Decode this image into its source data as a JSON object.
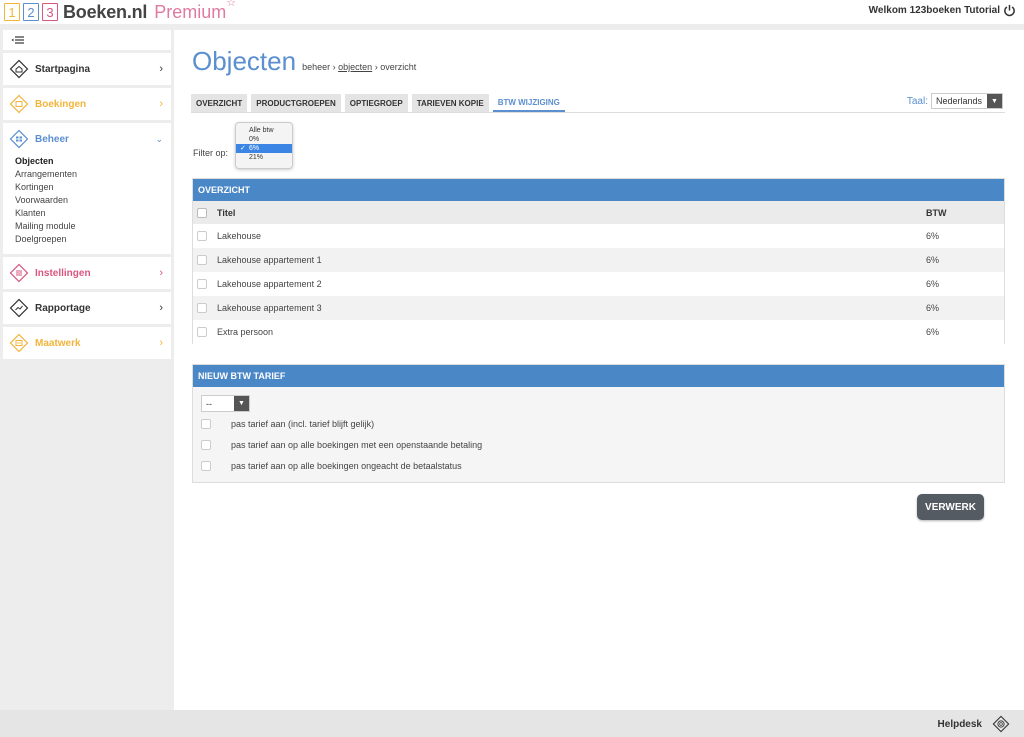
{
  "header": {
    "logo_digits": [
      "1",
      "2",
      "3"
    ],
    "brand": "Boeken.nl",
    "premium": "Premium",
    "welcome": "Welkom 123boeken Tutorial"
  },
  "sidebar": {
    "items": [
      {
        "label": "Startpagina",
        "color": "#333333"
      },
      {
        "label": "Boekingen",
        "color": "#f2b53c"
      },
      {
        "label": "Beheer",
        "color": "#5b8fcf"
      },
      {
        "label": "Instellingen",
        "color": "#d9577f"
      },
      {
        "label": "Rapportage",
        "color": "#333333"
      },
      {
        "label": "Maatwerk",
        "color": "#f2b53c"
      }
    ],
    "beheer_sub": [
      "Objecten",
      "Arrangementen",
      "Kortingen",
      "Voorwaarden",
      "Klanten",
      "Mailing module",
      "Doelgroepen"
    ]
  },
  "main": {
    "title": "Objecten",
    "breadcrumb": {
      "part1": "beheer",
      "sep": "›",
      "part2": "objecten",
      "part3": "overzicht"
    },
    "tabs": [
      "OVERZICHT",
      "PRODUCTGROEPEN",
      "OPTIEGROEP",
      "TARIEVEN KOPIE",
      "BTW WIJZIGING"
    ],
    "active_tab": "BTW WIJZIGING",
    "taal_label": "Taal:",
    "taal_value": "Nederlands",
    "filter_label": "Filter op:",
    "filter_options": [
      "Alle btw",
      "0%",
      "6%",
      "21%"
    ],
    "filter_selected": "6%"
  },
  "overzicht": {
    "heading": "OVERZICHT",
    "col_title": "Titel",
    "col_btw": "BTW",
    "rows": [
      {
        "title": "Lakehouse",
        "btw": "6%"
      },
      {
        "title": "Lakehouse appartement 1",
        "btw": "6%"
      },
      {
        "title": "Lakehouse appartement 2",
        "btw": "6%"
      },
      {
        "title": "Lakehouse appartement 3",
        "btw": "6%"
      },
      {
        "title": "Extra persoon",
        "btw": "6%"
      }
    ]
  },
  "nieuw": {
    "heading": "NIEUW BTW TARIEF",
    "select_value": "--",
    "options": [
      "pas tarief aan (incl. tarief blijft gelijk)",
      "pas tarief aan op alle boekingen met een openstaande betaling",
      "pas tarief aan op alle boekingen ongeacht de betaalstatus"
    ],
    "submit": "VERWERK"
  },
  "footer": {
    "helpdesk": "Helpdesk"
  }
}
